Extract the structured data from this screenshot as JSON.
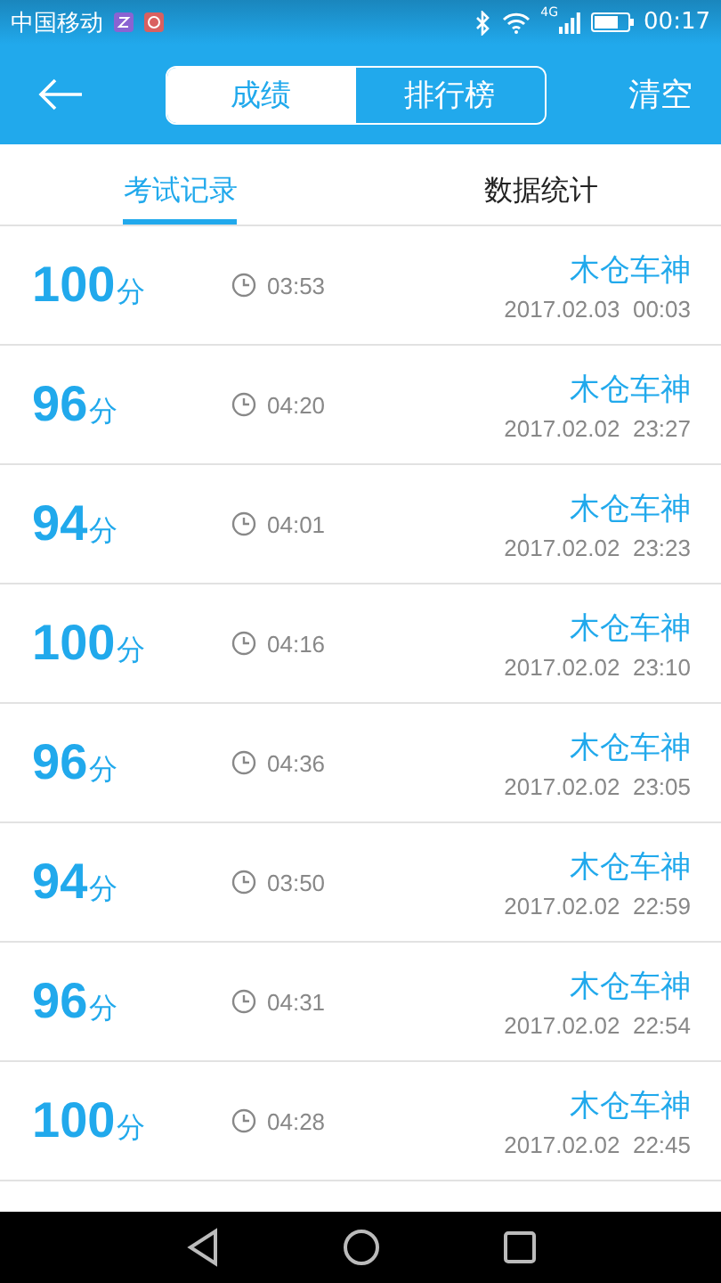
{
  "status_bar": {
    "carrier": "中国移动",
    "network": "4G",
    "time": "00:17"
  },
  "header": {
    "segments": [
      {
        "label": "成绩",
        "selected": true
      },
      {
        "label": "排行榜",
        "selected": false
      }
    ],
    "action": "清空"
  },
  "tabs": [
    {
      "label": "考试记录",
      "selected": true
    },
    {
      "label": "数据统计",
      "selected": false
    }
  ],
  "records": [
    {
      "score": "100",
      "unit": "分",
      "duration": "03:53",
      "name": "木仓车神",
      "date": "2017.02.03",
      "time": "00:03"
    },
    {
      "score": "96",
      "unit": "分",
      "duration": "04:20",
      "name": "木仓车神",
      "date": "2017.02.02",
      "time": "23:27"
    },
    {
      "score": "94",
      "unit": "分",
      "duration": "04:01",
      "name": "木仓车神",
      "date": "2017.02.02",
      "time": "23:23"
    },
    {
      "score": "100",
      "unit": "分",
      "duration": "04:16",
      "name": "木仓车神",
      "date": "2017.02.02",
      "time": "23:10"
    },
    {
      "score": "96",
      "unit": "分",
      "duration": "04:36",
      "name": "木仓车神",
      "date": "2017.02.02",
      "time": "23:05"
    },
    {
      "score": "94",
      "unit": "分",
      "duration": "03:50",
      "name": "木仓车神",
      "date": "2017.02.02",
      "time": "22:59"
    },
    {
      "score": "96",
      "unit": "分",
      "duration": "04:31",
      "name": "木仓车神",
      "date": "2017.02.02",
      "time": "22:54"
    },
    {
      "score": "100",
      "unit": "分",
      "duration": "04:28",
      "name": "木仓车神",
      "date": "2017.02.02",
      "time": "22:45"
    }
  ]
}
